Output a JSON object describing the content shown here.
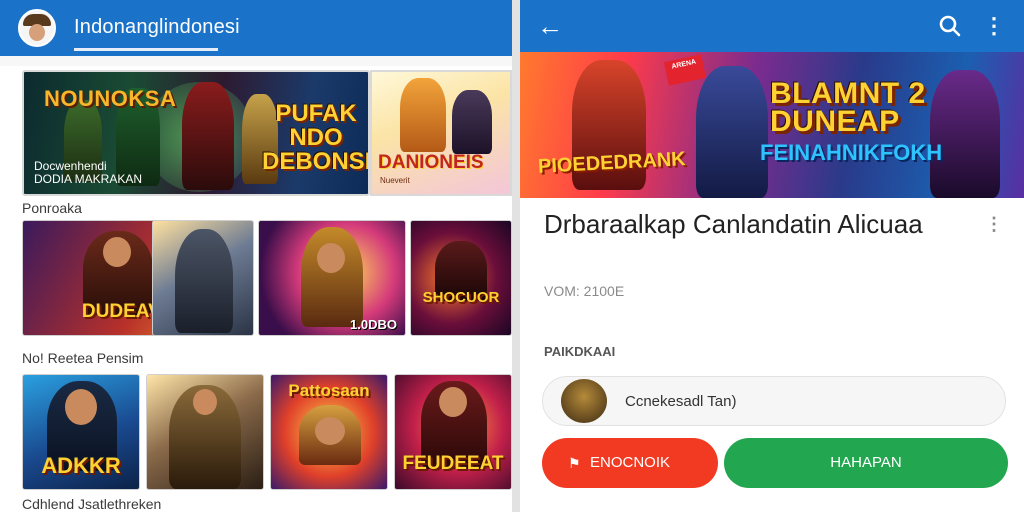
{
  "left": {
    "app_title": "Indonanglindonesi",
    "hero_banner": {
      "headline": "NOUNOKSA",
      "logo_text": "PUFAK NDO DEBONSBR",
      "subtitle_line1": "Docwenhendi",
      "subtitle_line2": "DODIA MAKRAKAN"
    },
    "side_banner": {
      "title": "DANIONEIS",
      "subtitle": "Nueverit"
    },
    "section1_label": "Ponroaka",
    "row1_thumbs": [
      {
        "label": "DUDEAVAIR"
      },
      {
        "label": ""
      },
      {
        "label": "1.0DBO"
      },
      {
        "label": "SHOCUOR"
      }
    ],
    "section2_label": "No! Reetea Pensim",
    "row2_thumbs": [
      {
        "label": "ADKKR"
      },
      {
        "label": ""
      },
      {
        "label": "Pattosaan"
      },
      {
        "label": "FEUDEEAT"
      }
    ],
    "section3_label": "Cdhlend Jsatlethreken"
  },
  "right": {
    "banner": {
      "title": "BLAMNT 2 DUNEAP",
      "subtitle": "FEINAHNIKFOKH",
      "left_logo": "PIOEDEDRANK",
      "badge": "ARENA"
    },
    "title": "Drbaraalkap Canlandatin Alicuaa",
    "version": "VOM: 2100E",
    "section_label": "PAIKDKAAI",
    "comment_placeholder": "Ccnekesadl Tan)",
    "red_button_label": "ENOCNOIK",
    "green_button_label": "HAHAPAN"
  },
  "colors": {
    "app_bar": "#1a73c9",
    "red_button": "#f23a22",
    "green_button": "#22a64f"
  },
  "icons": {
    "back": "arrow-left-icon",
    "search": "search-icon",
    "more": "more-vertical-icon"
  }
}
